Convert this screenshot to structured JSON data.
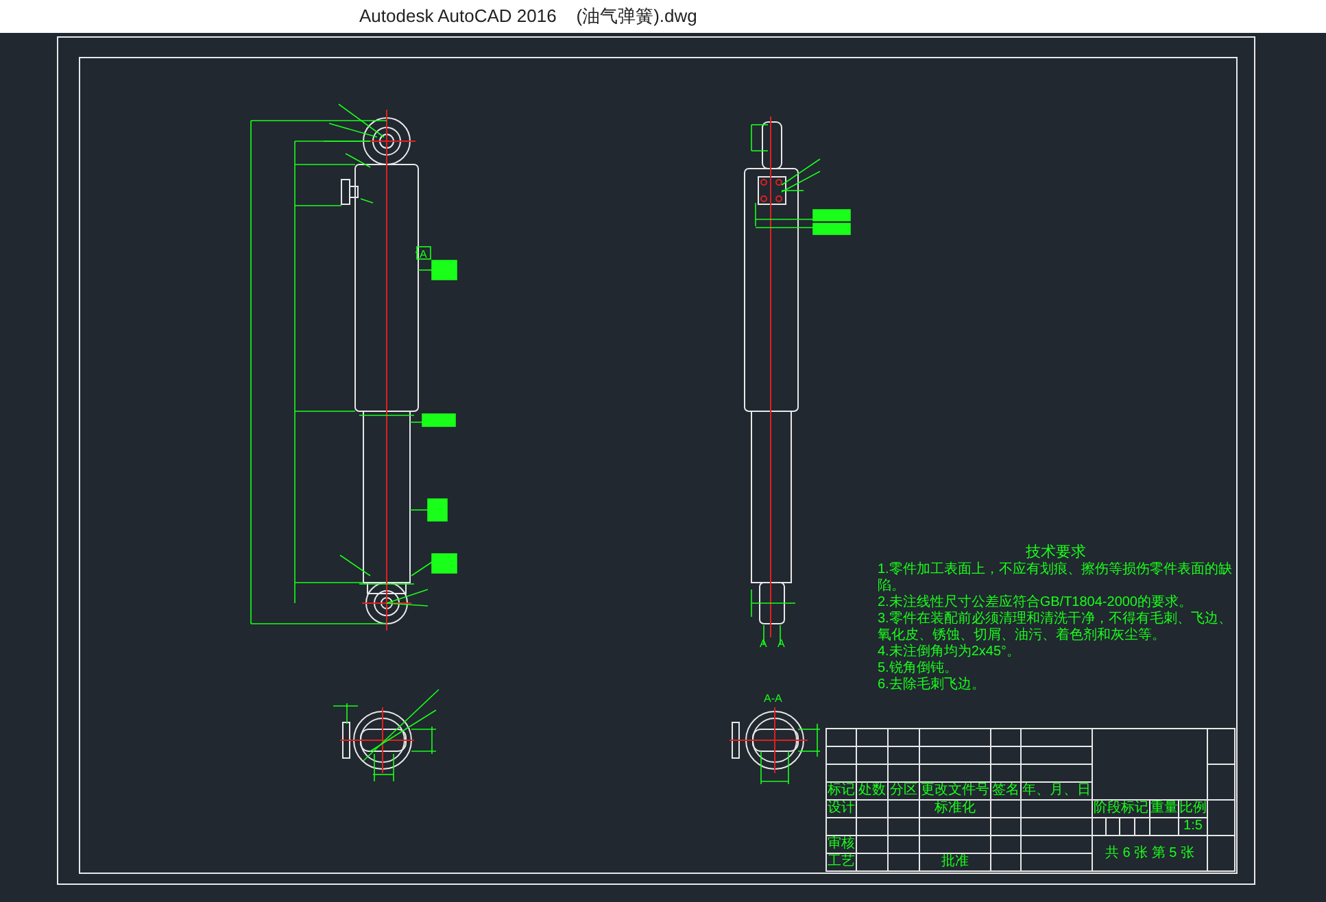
{
  "window": {
    "title": "Autodesk AutoCAD 2016    (油气弹簧).dwg"
  },
  "drawing": {
    "front_view_datum": "A",
    "section_marks": [
      "A",
      "A"
    ],
    "section_title": "A-A"
  },
  "technical_requirements": {
    "heading": "技术要求",
    "items": [
      "1.零件加工表面上，不应有划痕、擦伤等损伤零件表面的缺陷。",
      "2.未注线性尺寸公差应符合GB/T1804-2000的要求。",
      "3.零件在装配前必须清理和清洗干净，不得有毛刺、飞边、氧化皮、锈蚀、切屑、油污、着色剂和灰尘等。",
      "4.未注倒角均为2x45°。",
      "5.锐角倒钝。",
      "6.去除毛刺飞边。"
    ]
  },
  "title_block": {
    "revision_headers": [
      "标记",
      "处数",
      "分区",
      "更改文件号",
      "签名",
      "年、月、日"
    ],
    "designer_label": "设计",
    "standardization_label": "标准化",
    "reviewer_label": "审核",
    "process_label": "工艺",
    "approval_label": "批准",
    "stage_headers": [
      "阶段标记",
      "重量",
      "比例"
    ],
    "scale": "1:5",
    "sheets": "共 6 张 第 5 张"
  }
}
